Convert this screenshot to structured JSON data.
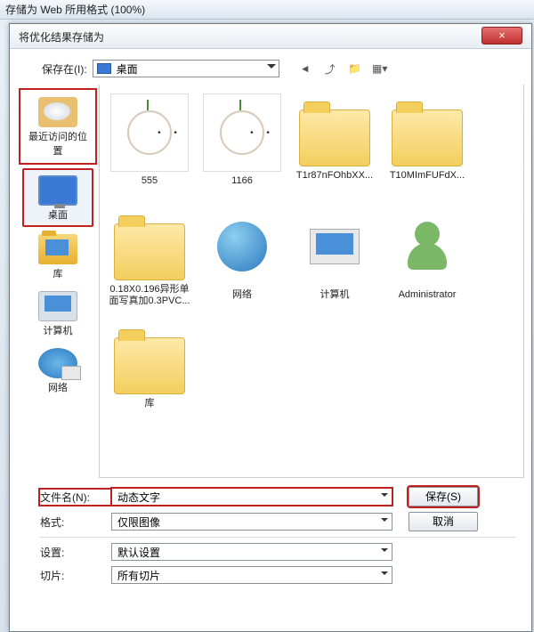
{
  "outer": {
    "title": "存储为 Web 所用格式 (100%)"
  },
  "dialog": {
    "title": "将优化结果存储为",
    "close": "×",
    "save_in_label": "保存在(I):",
    "save_in_value": "桌面"
  },
  "sidebar": [
    {
      "label": "最近访问的位置"
    },
    {
      "label": "桌面"
    },
    {
      "label": "库"
    },
    {
      "label": "计算机"
    },
    {
      "label": "网络"
    }
  ],
  "files": [
    {
      "name": "555"
    },
    {
      "name": "1166"
    },
    {
      "name": "T1r87nFOhbXX..."
    },
    {
      "name": "T10MImFUFdX..."
    },
    {
      "name": "0.18X0.196异形单面写真加0.3PVC..."
    },
    {
      "name": "网络"
    },
    {
      "name": "计算机"
    },
    {
      "name": "Administrator"
    },
    {
      "name": "库"
    }
  ],
  "form": {
    "filename_label": "文件名(N):",
    "filename_value": "动态文字",
    "format_label": "格式:",
    "format_value": "仅限图像",
    "settings_label": "设置:",
    "settings_value": "默认设置",
    "slices_label": "切片:",
    "slices_value": "所有切片",
    "save_btn": "保存(S)",
    "cancel_btn": "取消"
  }
}
